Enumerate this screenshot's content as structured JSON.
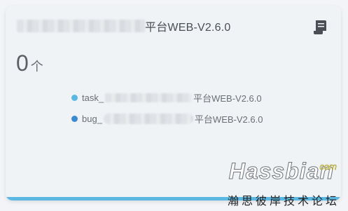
{
  "card": {
    "title_suffix": "平台WEB-V2.6.0",
    "icon": "document-scroll-icon",
    "count_value": "0",
    "count_unit": "个",
    "legend": [
      {
        "prefix": "task_",
        "suffix": "平台WEB-V2.6.0",
        "color": "#5ab8e3"
      },
      {
        "prefix": "bug_",
        "suffix": "平台WEB-V2.6.0",
        "color": "#3a8ad0"
      }
    ],
    "accent_color": "#5ab8e3"
  },
  "watermark": {
    "name": "Hassbian",
    "com": "com",
    "subtitle": "瀚思彼岸技术论坛"
  }
}
